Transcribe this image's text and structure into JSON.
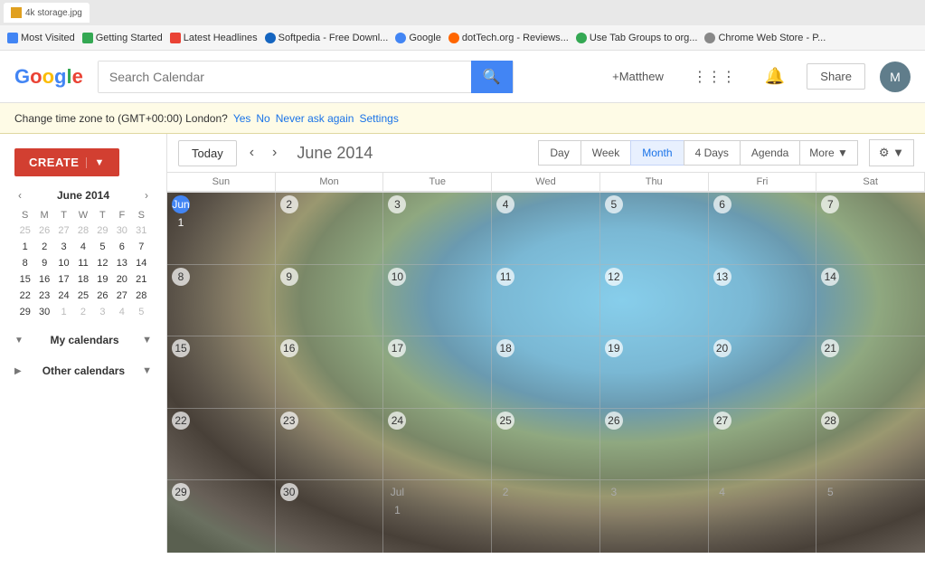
{
  "browser": {
    "bookmarks": [
      {
        "label": "Most Visited",
        "id": "most-visited"
      },
      {
        "label": "Getting Started",
        "id": "getting-started"
      },
      {
        "label": "Latest Headlines",
        "id": "latest-headlines"
      },
      {
        "label": "Softpedia - Free Downl...",
        "id": "softpedia"
      },
      {
        "label": "Google",
        "id": "google"
      },
      {
        "label": "dotTech.org - Reviews...",
        "id": "dottech"
      },
      {
        "label": "Use Tab Groups to org...",
        "id": "tab-groups"
      },
      {
        "label": "Chrome Web Store - P...",
        "id": "chrome-store"
      }
    ],
    "active_tab": "4k storage.jpg"
  },
  "header": {
    "logo": "Google",
    "logo_letters": [
      "G",
      "o",
      "o",
      "g",
      "l",
      "e"
    ],
    "search_placeholder": "Search Calendar",
    "user_label": "+Matthew",
    "share_label": "Share"
  },
  "timezone_banner": {
    "message": "Change time zone to (GMT+00:00) London?",
    "yes": "Yes",
    "no": "No",
    "never": "Never ask again",
    "settings": "Settings"
  },
  "toolbar": {
    "today": "Today",
    "month_title": "June 2014",
    "views": [
      "Day",
      "Week",
      "Month",
      "4 Days",
      "Agenda"
    ],
    "active_view": "Month",
    "more": "More",
    "settings_icon": "⚙"
  },
  "sidebar": {
    "create_label": "CREATE",
    "mini_calendar": {
      "title": "June 2014",
      "days_of_week": [
        "S",
        "M",
        "T",
        "W",
        "T",
        "F",
        "S"
      ],
      "weeks": [
        [
          {
            "n": "25",
            "m": true
          },
          {
            "n": "26",
            "m": true
          },
          {
            "n": "27",
            "m": true
          },
          {
            "n": "28",
            "m": true
          },
          {
            "n": "29",
            "m": true
          },
          {
            "n": "30",
            "m": true
          },
          {
            "n": "31",
            "m": true
          }
        ],
        [
          {
            "n": "1"
          },
          {
            "n": "2"
          },
          {
            "n": "3"
          },
          {
            "n": "4"
          },
          {
            "n": "5"
          },
          {
            "n": "6"
          },
          {
            "n": "7"
          }
        ],
        [
          {
            "n": "8"
          },
          {
            "n": "9"
          },
          {
            "n": "10"
          },
          {
            "n": "11"
          },
          {
            "n": "12"
          },
          {
            "n": "13"
          },
          {
            "n": "14"
          }
        ],
        [
          {
            "n": "15"
          },
          {
            "n": "16"
          },
          {
            "n": "17"
          },
          {
            "n": "18"
          },
          {
            "n": "19"
          },
          {
            "n": "20"
          },
          {
            "n": "21"
          }
        ],
        [
          {
            "n": "22"
          },
          {
            "n": "23"
          },
          {
            "n": "24"
          },
          {
            "n": "25"
          },
          {
            "n": "26"
          },
          {
            "n": "27"
          },
          {
            "n": "28"
          }
        ],
        [
          {
            "n": "29"
          },
          {
            "n": "30"
          },
          {
            "n": "1",
            "m": true
          },
          {
            "n": "2",
            "m": true
          },
          {
            "n": "3",
            "m": true
          },
          {
            "n": "4",
            "m": true
          },
          {
            "n": "5",
            "m": true
          }
        ]
      ]
    },
    "my_calendars": "My calendars",
    "other_calendars": "Other calendars"
  },
  "calendar": {
    "headers": [
      "Sun",
      "Mon",
      "Tue",
      "Wed",
      "Thu",
      "Fri",
      "Sat"
    ],
    "weeks": [
      [
        {
          "n": "Jun 1",
          "dim": false
        },
        {
          "n": "2"
        },
        {
          "n": "3"
        },
        {
          "n": "4"
        },
        {
          "n": "5"
        },
        {
          "n": "6"
        },
        {
          "n": "7"
        }
      ],
      [
        {
          "n": "8"
        },
        {
          "n": "9"
        },
        {
          "n": "10"
        },
        {
          "n": "11"
        },
        {
          "n": "12"
        },
        {
          "n": "13"
        },
        {
          "n": "14"
        }
      ],
      [
        {
          "n": "15"
        },
        {
          "n": "16"
        },
        {
          "n": "17"
        },
        {
          "n": "18"
        },
        {
          "n": "19"
        },
        {
          "n": "20"
        },
        {
          "n": "21"
        }
      ],
      [
        {
          "n": "22"
        },
        {
          "n": "23"
        },
        {
          "n": "24"
        },
        {
          "n": "25"
        },
        {
          "n": "26"
        },
        {
          "n": "27"
        },
        {
          "n": "28"
        }
      ],
      [
        {
          "n": "29"
        },
        {
          "n": "30"
        },
        {
          "n": "Jul 1",
          "dim": true
        },
        {
          "n": "2",
          "dim": true
        },
        {
          "n": "3",
          "dim": true
        },
        {
          "n": "4",
          "dim": true
        },
        {
          "n": "5",
          "dim": true
        }
      ]
    ]
  }
}
